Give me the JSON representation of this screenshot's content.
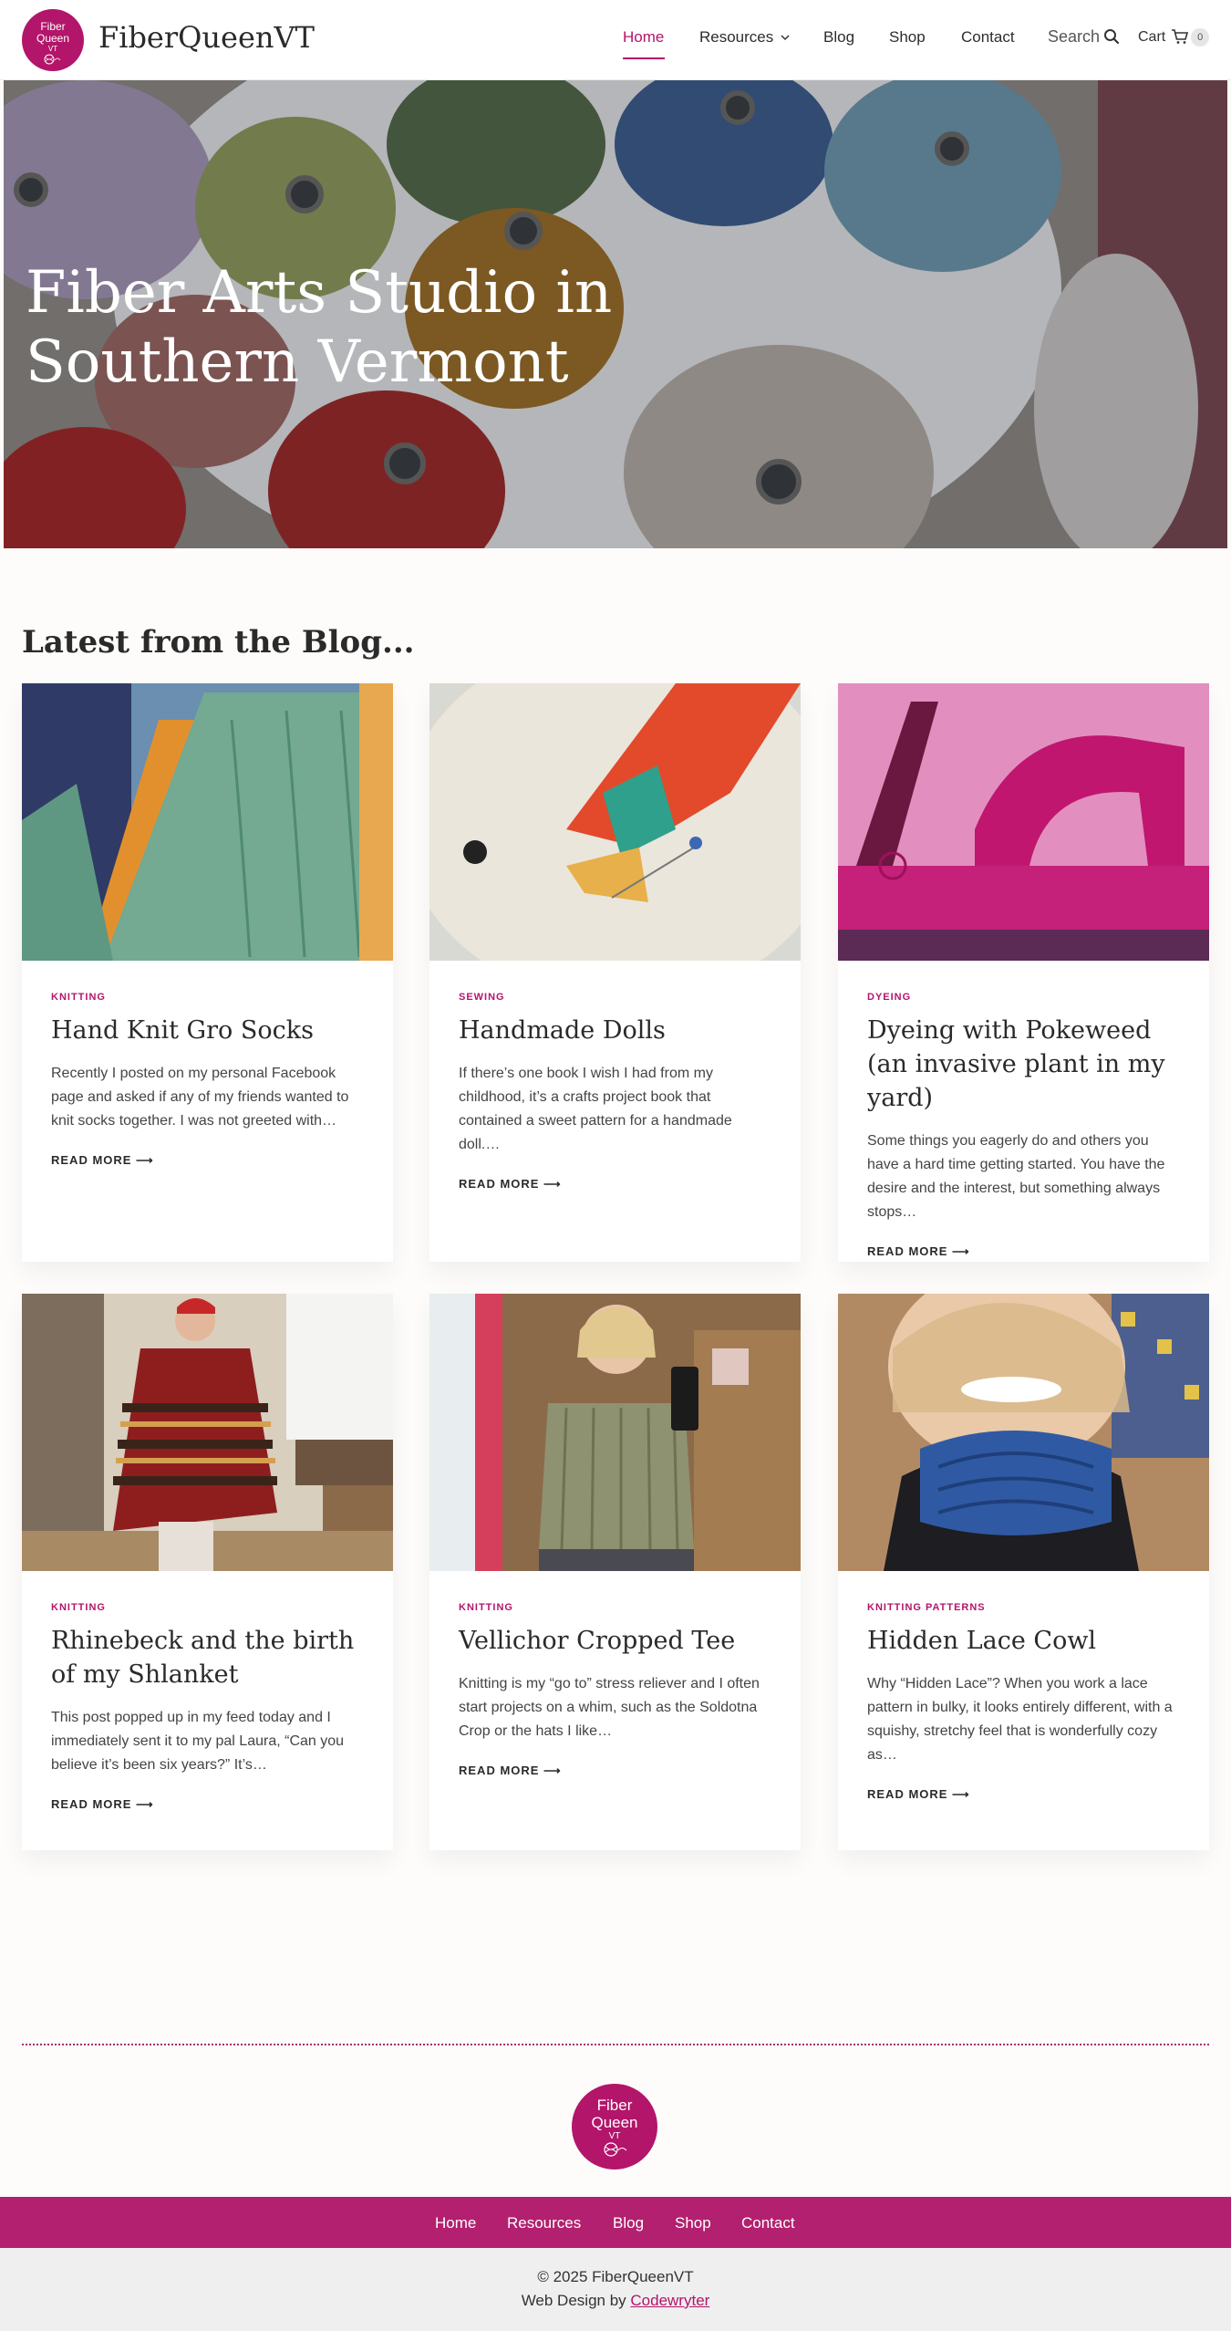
{
  "site": {
    "logo": {
      "line1": "Fiber",
      "line2": "Queen",
      "line3": "VT"
    },
    "title": "FiberQueenVT"
  },
  "nav": {
    "home": "Home",
    "resources": "Resources",
    "blog": "Blog",
    "shop": "Shop",
    "contact": "Contact",
    "search_label": "Search",
    "cart_label": "Cart",
    "cart_count": "0"
  },
  "hero": {
    "title_line1": "Fiber Arts Studio in",
    "title_line2": "Southern Vermont"
  },
  "blog": {
    "heading": "Latest from the Blog...",
    "read_more": "READ MORE ⟶",
    "posts": [
      {
        "category": "KNITTING",
        "title": "Hand Knit Gro Socks",
        "excerpt": "Recently I posted on my personal Facebook page and asked if any of my friends wanted to knit socks together. I was not greeted with…"
      },
      {
        "category": "SEWING",
        "title": "Handmade Dolls",
        "excerpt": "If there’s one book I wish I had from my childhood, it’s a crafts project book that contained a sweet pattern for a handmade doll.…"
      },
      {
        "category": "DYEING",
        "title": "Dyeing with Pokeweed (an invasive plant in my yard)",
        "excerpt": "Some things you eagerly do and others you have a hard time getting started. You have the desire and the interest, but something always stops…"
      },
      {
        "category": "KNITTING",
        "title": "Rhinebeck and the birth of my Shlanket",
        "excerpt": "This post popped up in my feed today and I immediately sent it to my pal Laura, “Can you believe it’s been six years?” It’s…"
      },
      {
        "category": "KNITTING",
        "title": "Vellichor Cropped Tee",
        "excerpt": "Knitting is my “go to” stress reliever and I often start projects on a whim, such as the Soldotna Crop or the hats I like…"
      },
      {
        "category": "KNITTING PATTERNS",
        "title": "Hidden Lace Cowl",
        "excerpt": "Why “Hidden Lace”? When you work a lace pattern in bulky, it looks entirely different, with a squishy, stretchy feel that is wonderfully cozy as…"
      }
    ]
  },
  "footer": {
    "logo": {
      "line1": "Fiber",
      "line2": "Queen",
      "line3": "VT"
    },
    "nav": {
      "home": "Home",
      "resources": "Resources",
      "blog": "Blog",
      "shop": "Shop",
      "contact": "Contact"
    },
    "copyright": "© 2025 FiberQueenVT",
    "credit_prefix": "Web Design by ",
    "credit_link": "Codewryter"
  },
  "colors": {
    "brand": "#b3156b",
    "footer_bar": "#b3206f",
    "footer_bottom": "#efefef"
  }
}
